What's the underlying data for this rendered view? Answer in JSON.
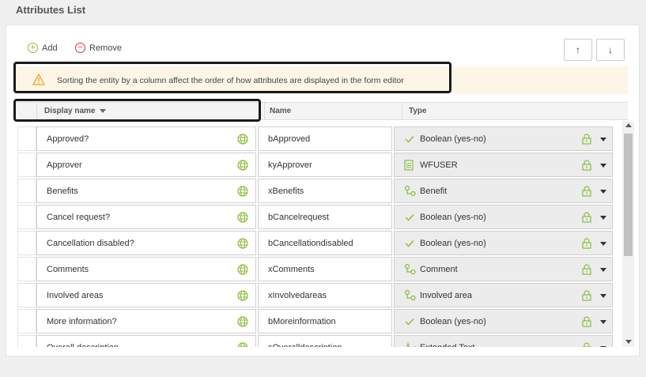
{
  "page": {
    "title": "Attributes List"
  },
  "toolbar": {
    "add_label": "Add",
    "remove_label": "Remove",
    "move_up_label": "↑",
    "move_down_label": "↓"
  },
  "alert": {
    "message": "Sorting the entity by a column affect the order of how attributes are displayed in the form editor",
    "icon": "warning-icon"
  },
  "grid": {
    "columns": {
      "display_name": "Display name",
      "name": "Name",
      "type": "Type"
    },
    "sort_column": "Display name",
    "rows": [
      {
        "display_name": "Approved?",
        "name": "bApproved",
        "type": "Boolean (yes-no)",
        "type_icon": "check"
      },
      {
        "display_name": "Approver",
        "name": "kyApprover",
        "type": "WFUSER",
        "type_icon": "table"
      },
      {
        "display_name": "Benefits",
        "name": "xBenefits",
        "type": "Benefit",
        "type_icon": "entity"
      },
      {
        "display_name": "Cancel request?",
        "name": "bCancelrequest",
        "type": "Boolean (yes-no)",
        "type_icon": "check"
      },
      {
        "display_name": "Cancellation disabled?",
        "name": "bCancellationdisabled",
        "type": "Boolean (yes-no)",
        "type_icon": "check"
      },
      {
        "display_name": "Comments",
        "name": "xComments",
        "type": "Comment",
        "type_icon": "entity"
      },
      {
        "display_name": "Involved areas",
        "name": "xInvolvedareas",
        "type": "Involved area",
        "type_icon": "entity"
      },
      {
        "display_name": "More information?",
        "name": "bMoreinformation",
        "type": "Boolean (yes-no)",
        "type_icon": "check"
      },
      {
        "display_name": "Overall description",
        "name": "sOveralldescription",
        "type": "Extended Text",
        "type_icon": "text"
      }
    ]
  },
  "colors": {
    "add_icon": "#8bbd3a",
    "remove_icon": "#d33333",
    "alert_bg": "#fdf5e6",
    "warning": "#f0a020",
    "icon_green": "#8bbd3a"
  }
}
